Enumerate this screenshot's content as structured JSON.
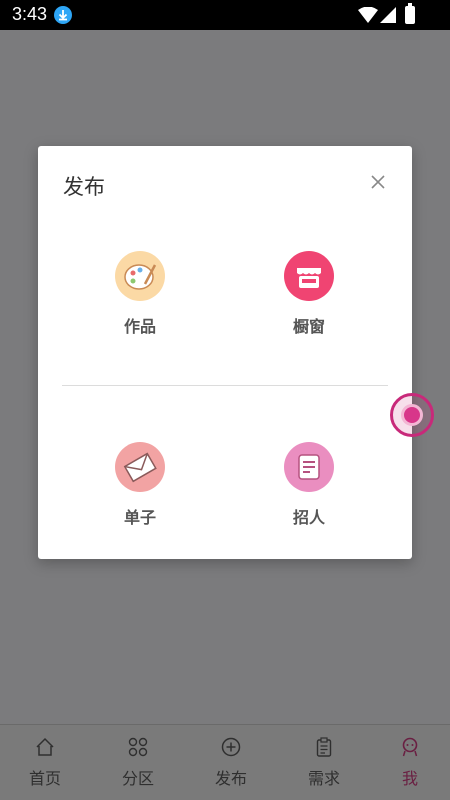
{
  "status_bar": {
    "time": "3:43"
  },
  "dialog": {
    "title": "发布",
    "options": [
      {
        "label": "作品",
        "icon": "palette-icon",
        "color": "#fbd9a5"
      },
      {
        "label": "橱窗",
        "icon": "storefront-icon",
        "color": "#f04472"
      },
      {
        "label": "单子",
        "icon": "envelope-icon",
        "color": "#f2a3a3"
      },
      {
        "label": "招人",
        "icon": "document-icon",
        "color": "#ea8ec0"
      }
    ]
  },
  "tab_bar": {
    "tabs": [
      {
        "label": "首页",
        "icon": "home-icon"
      },
      {
        "label": "分区",
        "icon": "grid-icon"
      },
      {
        "label": "发布",
        "icon": "plus-circle-icon"
      },
      {
        "label": "需求",
        "icon": "clipboard-icon"
      },
      {
        "label": "我",
        "icon": "profile-icon"
      }
    ],
    "active_tab": "我"
  },
  "colors": {
    "accent": "#c8297a",
    "overlay": "#7b7b7d"
  }
}
